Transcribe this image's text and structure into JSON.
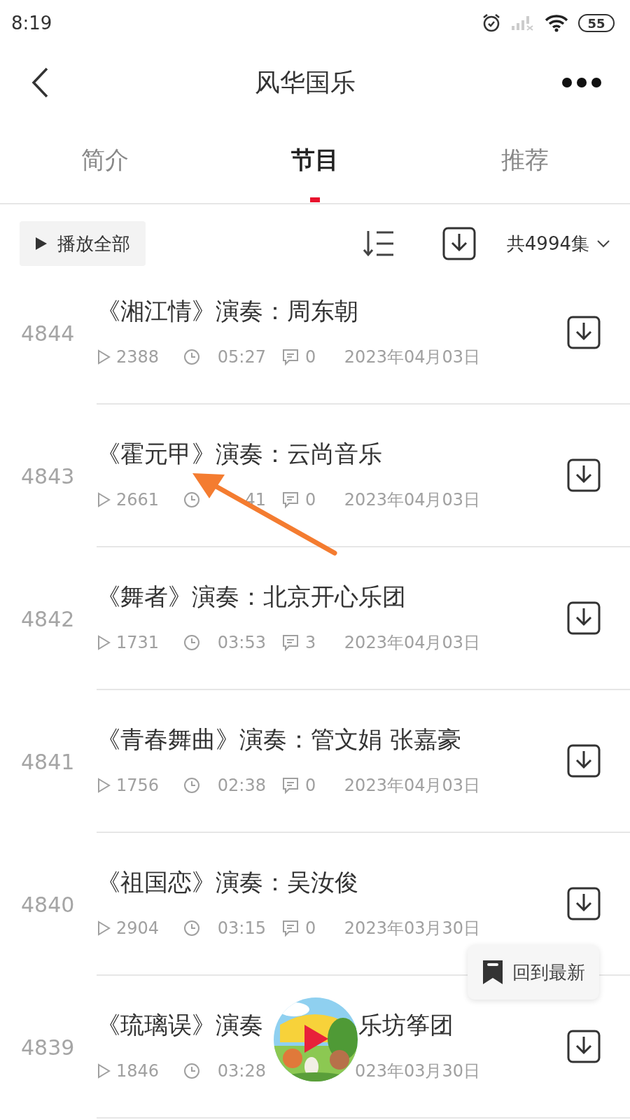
{
  "status_bar": {
    "time": "8:19",
    "battery": "55"
  },
  "header": {
    "title": "风华国乐"
  },
  "tabs": [
    {
      "label": "简介",
      "selected": false
    },
    {
      "label": "节目",
      "selected": true
    },
    {
      "label": "推荐",
      "selected": false
    }
  ],
  "toolbar": {
    "play_all": "播放全部",
    "count": "共4994集"
  },
  "episodes": [
    {
      "number": "4844",
      "title": "《湘江情》演奏：周东朝",
      "plays": "2388",
      "duration": "05:27",
      "comments": "0",
      "date": "2023年04月03日"
    },
    {
      "number": "4843",
      "title": "《霍元甲》演奏：云尚音乐",
      "plays": "2661",
      "duration": "41",
      "comments": "0",
      "date": "2023年04月03日"
    },
    {
      "number": "4842",
      "title": "《舞者》演奏：北京开心乐团",
      "plays": "1731",
      "duration": "03:53",
      "comments": "3",
      "date": "2023年04月03日"
    },
    {
      "number": "4841",
      "title": "《青春舞曲》演奏：管文娟 张嘉豪",
      "plays": "1756",
      "duration": "02:38",
      "comments": "0",
      "date": "2023年04月03日"
    },
    {
      "number": "4840",
      "title": "《祖国恋》演奏：吴汝俊",
      "plays": "2904",
      "duration": "03:15",
      "comments": "0",
      "date": "2023年03月30日"
    },
    {
      "number": "4839",
      "title": "《琉璃误》演奏",
      "title_tail": "乐坊筝团",
      "plays": "1846",
      "duration": "03:28",
      "date": "023年03月30日"
    }
  ],
  "floating_button": {
    "label": "回到最新"
  },
  "annotation": {
    "kind": "arrow",
    "color": "#f47c30"
  }
}
